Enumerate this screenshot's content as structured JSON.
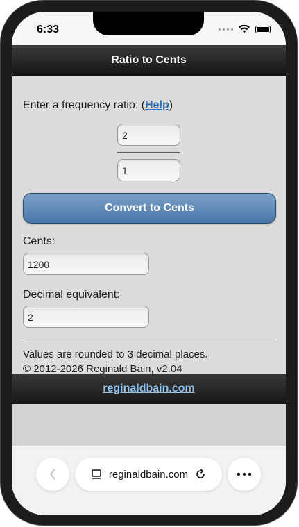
{
  "status": {
    "time": "6:33"
  },
  "header": {
    "title": "Ratio to Cents"
  },
  "form": {
    "prompt_text": "Enter a frequency ratio: (",
    "help_label": "Help",
    "prompt_close": ")",
    "numerator_value": "2",
    "denominator_value": "1",
    "convert_label": "Convert to Cents",
    "cents_label": "Cents:",
    "cents_value": "1200",
    "decimal_label": "Decimal equivalent:",
    "decimal_value": "2",
    "note_rounded": "Values are rounded to 3 decimal places.",
    "copyright": "© 2012-2026 Reginald Bain, v2.04"
  },
  "footer": {
    "link_label": "reginaldbain.com"
  },
  "browser": {
    "url": "reginaldbain.com",
    "back_icon": "chevron-left-icon",
    "reader_icon": "reader-icon",
    "reload_icon": "reload-icon",
    "more_icon": "ellipsis-icon"
  }
}
